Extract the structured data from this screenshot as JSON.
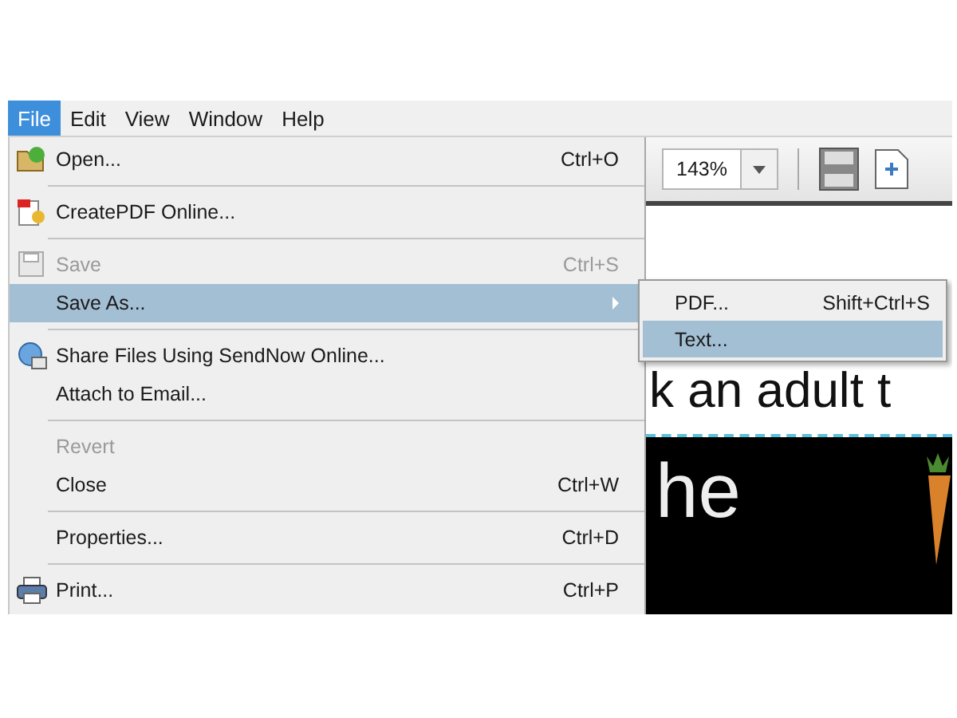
{
  "menubar": [
    {
      "label": "File",
      "selected": true
    },
    {
      "label": "Edit",
      "selected": false
    },
    {
      "label": "View",
      "selected": false
    },
    {
      "label": "Window",
      "selected": false
    },
    {
      "label": "Help",
      "selected": false
    }
  ],
  "file_menu": [
    {
      "kind": "item",
      "label": "Open...",
      "shortcut": "Ctrl+O",
      "disabled": false,
      "selected": false
    },
    {
      "kind": "separator"
    },
    {
      "kind": "item",
      "label": "CreatePDF Online...",
      "disabled": false,
      "selected": false
    },
    {
      "kind": "separator"
    },
    {
      "kind": "item",
      "label": "Save",
      "shortcut": "Ctrl+S",
      "disabled": true,
      "selected": false
    },
    {
      "kind": "submenu",
      "label": "Save As...",
      "disabled": false,
      "selected": true
    },
    {
      "kind": "separator"
    },
    {
      "kind": "item",
      "label": "Share Files Using SendNow Online...",
      "disabled": false,
      "selected": false
    },
    {
      "kind": "item",
      "label": "Attach to Email...",
      "disabled": false,
      "selected": false
    },
    {
      "kind": "separator"
    },
    {
      "kind": "item",
      "label": "Revert",
      "disabled": true,
      "selected": false
    },
    {
      "kind": "item",
      "label": "Close",
      "shortcut": "Ctrl+W",
      "disabled": false,
      "selected": false
    },
    {
      "kind": "separator"
    },
    {
      "kind": "item",
      "label": "Properties...",
      "shortcut": "Ctrl+D",
      "disabled": false,
      "selected": false
    },
    {
      "kind": "separator"
    },
    {
      "kind": "item",
      "label": "Print...",
      "shortcut": "Ctrl+P",
      "disabled": false,
      "selected": false
    }
  ],
  "save_as_submenu": [
    {
      "label": "PDF...",
      "shortcut": "Shift+Ctrl+S",
      "selected": false
    },
    {
      "label": "Text...",
      "selected": true
    }
  ],
  "toolbar": {
    "zoom": "143%"
  },
  "document": {
    "text_line": "k an adult t",
    "board_text": "he"
  }
}
